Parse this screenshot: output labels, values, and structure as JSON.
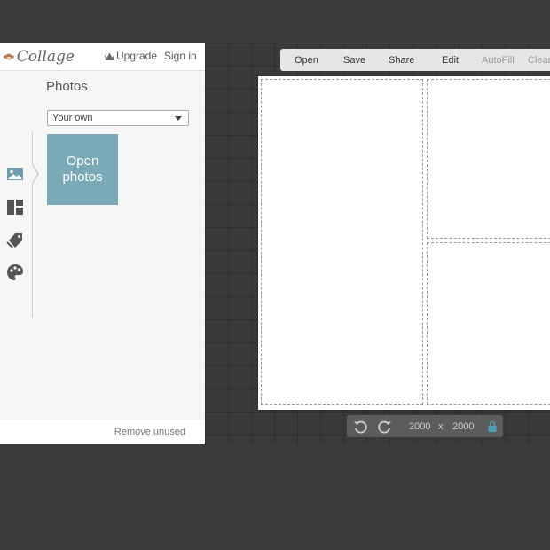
{
  "header": {
    "logo_text": "Collage",
    "upgrade_label": "Upgrade",
    "signin_label": "Sign in"
  },
  "sidebar": {
    "icons": [
      "photos-icon",
      "layout-icon",
      "tags-icon",
      "palette-icon"
    ],
    "active": "photos-icon"
  },
  "panel": {
    "title": "Photos",
    "source_select": "Your own",
    "open_photos_label": "Open photos",
    "remove_unused_label": "Remove unused"
  },
  "toolbar": {
    "open": "Open",
    "save": "Save",
    "share": "Share",
    "edit": "Edit",
    "autofill": "AutoFill",
    "clear": "Clear"
  },
  "canvas_size": {
    "width": "2000",
    "separator": "x",
    "height": "2000"
  },
  "colors": {
    "accent": "#7aaab8",
    "workspace": "#3a3a3a"
  }
}
